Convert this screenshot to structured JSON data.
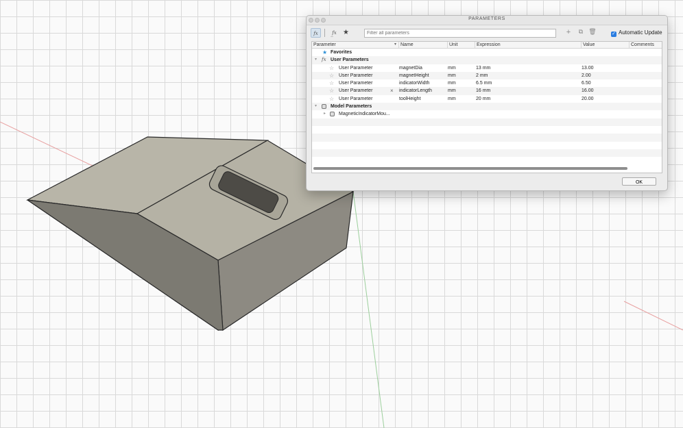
{
  "dialog": {
    "title": "PARAMETERS",
    "filter_placeholder": "Filter all parameters",
    "auto_update_label": "Automatic Update",
    "ok_label": "OK"
  },
  "columns": [
    "Parameter",
    "Name",
    "Unit",
    "Expression",
    "Value",
    "Comments"
  ],
  "groups": {
    "favorites": "Favorites",
    "user": "User Parameters",
    "model": "Model Parameters",
    "model_child": "MagneticIndicatorMou..."
  },
  "rows": [
    {
      "param": "User Parameter",
      "name": "magnetDia",
      "unit": "mm",
      "expression": "13 mm",
      "value": "13.00"
    },
    {
      "param": "User Parameter",
      "name": "magnetHeight",
      "unit": "mm",
      "expression": "2 mm",
      "value": "2.00"
    },
    {
      "param": "User Parameter",
      "name": "indicatorWidth",
      "unit": "mm",
      "expression": "6.5 mm",
      "value": "6.50"
    },
    {
      "param": "User Parameter",
      "name": "indicatorLength",
      "unit": "mm",
      "expression": "16 mm",
      "value": "16.00"
    },
    {
      "param": "User Parameter",
      "name": "toolHeight",
      "unit": "mm",
      "expression": "20 mm",
      "value": "20.00"
    }
  ],
  "icons": {
    "fx": "fx-icon",
    "star": "star-icon",
    "add": "plus-icon",
    "copy": "copy-icon",
    "delete": "trash-icon"
  }
}
